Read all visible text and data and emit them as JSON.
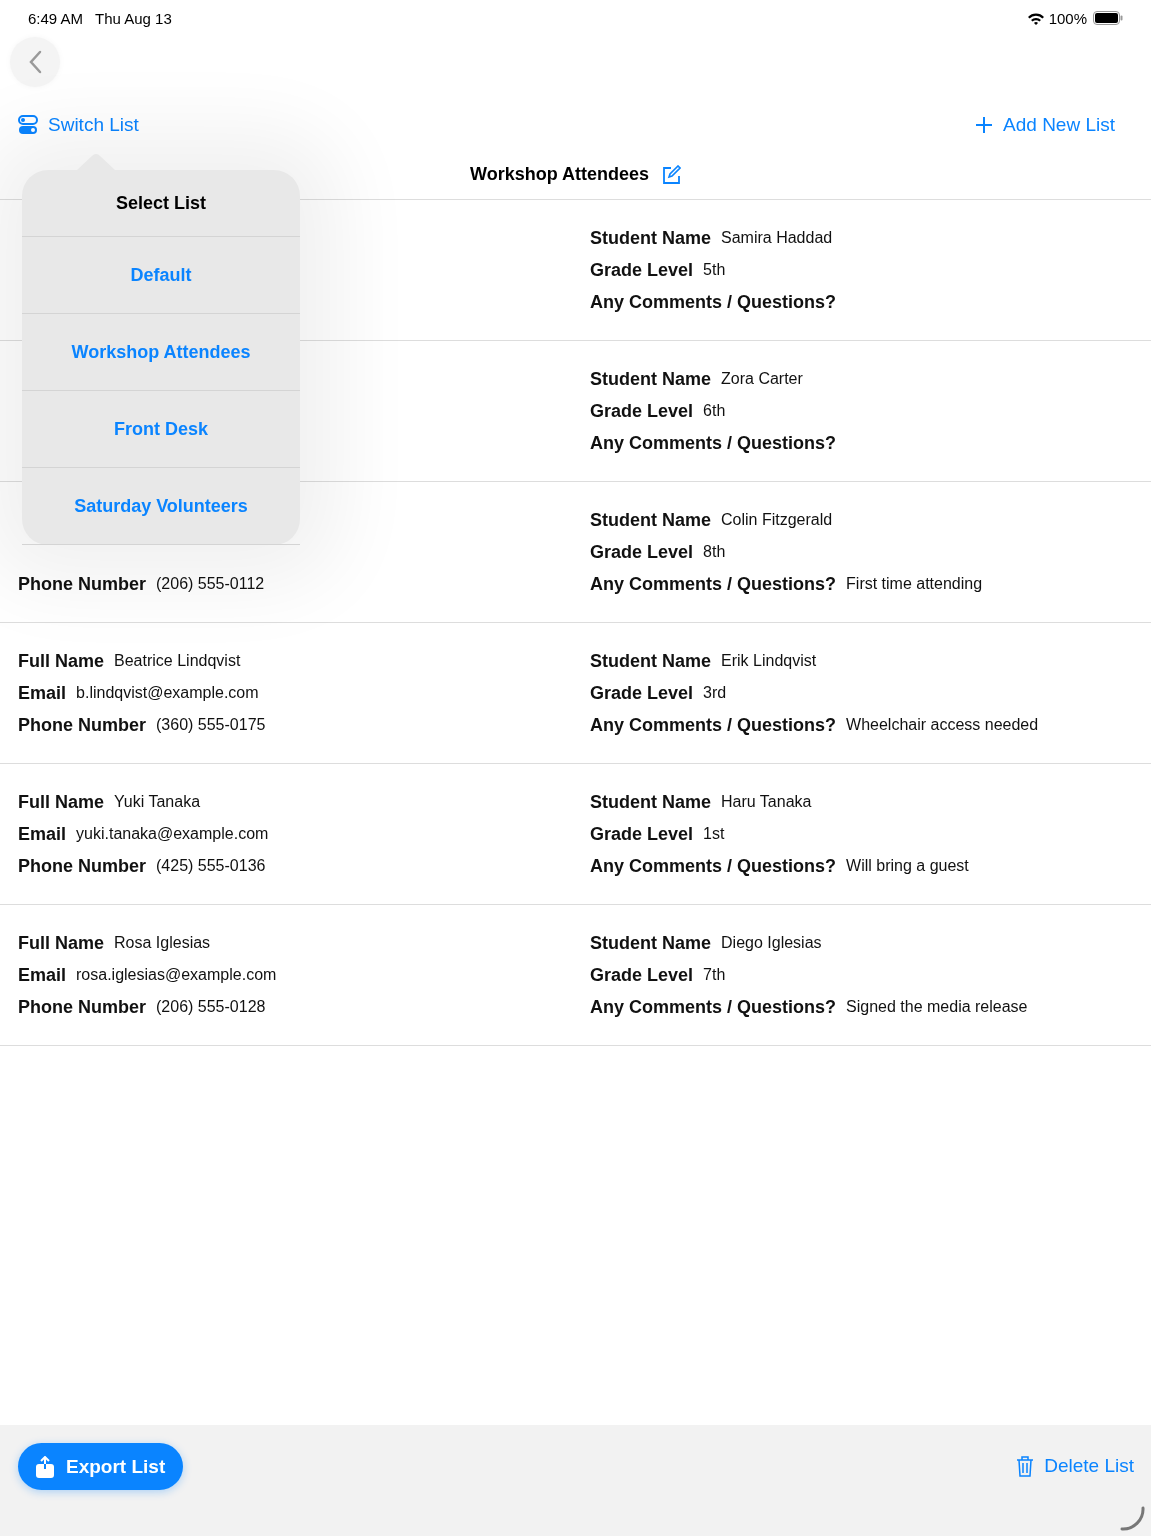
{
  "status_bar": {
    "time": "6:49 AM",
    "date": "Thu Aug 13",
    "battery": "100%"
  },
  "toolbar": {
    "switch_label": "Switch List",
    "add_label": "Add New List"
  },
  "list_title": "Workshop Attendees",
  "records": [
    {
      "right": [
        {
          "label": "Student Name",
          "value": "Samira Haddad"
        },
        {
          "label": "Grade Level",
          "value": "5th"
        },
        {
          "label": "Any Comments / Questions?"
        }
      ]
    },
    {
      "right": [
        {
          "label": "Student Name",
          "value": "Zora Carter"
        },
        {
          "label": "Grade Level",
          "value": "6th"
        },
        {
          "label": "Any Comments / Questions?"
        }
      ]
    },
    {
      "left": [
        {
          "label": "Phone Number",
          "value": "(206) 555-0112"
        }
      ],
      "right": [
        {
          "label": "Student Name",
          "value": "Colin Fitzgerald"
        },
        {
          "label": "Grade Level",
          "value": "8th"
        },
        {
          "label": "Any Comments / Questions?",
          "value": "First time attending"
        }
      ]
    },
    {
      "left": [
        {
          "label": "Full Name",
          "value": "Beatrice Lindqvist"
        },
        {
          "label": "Email",
          "value": "b.lindqvist@example.com"
        },
        {
          "label": "Phone Number",
          "value": "(360) 555-0175"
        }
      ],
      "right": [
        {
          "label": "Student Name",
          "value": "Erik Lindqvist"
        },
        {
          "label": "Grade Level",
          "value": "3rd"
        },
        {
          "label": "Any Comments / Questions?",
          "value": "Wheelchair access needed"
        }
      ]
    },
    {
      "left": [
        {
          "label": "Full Name",
          "value": "Yuki Tanaka"
        },
        {
          "label": "Email",
          "value": "yuki.tanaka@example.com"
        },
        {
          "label": "Phone Number",
          "value": "(425) 555-0136"
        }
      ],
      "right": [
        {
          "label": "Student Name",
          "value": "Haru Tanaka"
        },
        {
          "label": "Grade Level",
          "value": "1st"
        },
        {
          "label": "Any Comments / Questions?",
          "value": "Will bring a guest"
        }
      ]
    },
    {
      "left": [
        {
          "label": "Full Name",
          "value": "Rosa Iglesias"
        },
        {
          "label": "Email",
          "value": "rosa.iglesias@example.com"
        },
        {
          "label": "Phone Number",
          "value": "(206) 555-0128"
        }
      ],
      "right": [
        {
          "label": "Student Name",
          "value": "Diego Iglesias"
        },
        {
          "label": "Grade Level",
          "value": "7th"
        },
        {
          "label": "Any Comments / Questions?",
          "value": "Signed the media release"
        }
      ]
    }
  ],
  "popover": {
    "title": "Select List",
    "items": [
      "Default",
      "Workshop Attendees",
      "Front Desk",
      "Saturday Volunteers"
    ]
  },
  "bottom_bar": {
    "export_label": "Export List",
    "delete_label": "Delete List"
  }
}
